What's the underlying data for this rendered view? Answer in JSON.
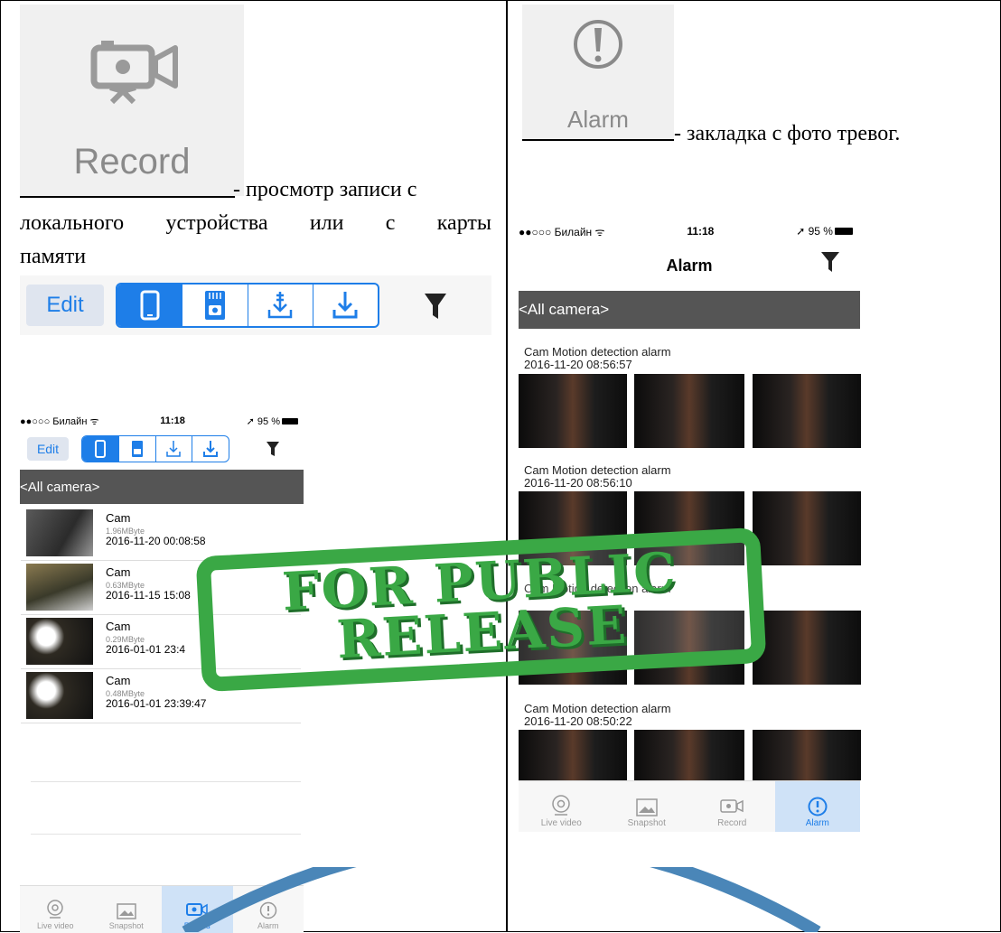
{
  "left_cell": {
    "tile_label": "Record",
    "description": "- просмотр записи с локального устройства или с карты памяти",
    "desc_line1": "- просмотр записи с",
    "desc_line2": "локального устройства или с карты",
    "desc_line3": "памяти",
    "toolbar": {
      "edit_label": "Edit"
    }
  },
  "right_cell": {
    "tile_label": "Alarm",
    "description": "- закладка с фото тревог."
  },
  "record_screen": {
    "status": {
      "carrier": "●●○○○ Билайн ᯤ",
      "time": "11:18",
      "battery": "➚ 95 %"
    },
    "toolbar": {
      "edit_label": "Edit"
    },
    "camera_filter": "<All camera>",
    "records": [
      {
        "name": "Cam",
        "size": "1.96MByte",
        "date": "2016-11-20 00:08:58"
      },
      {
        "name": "Cam",
        "size": "0.63MByte",
        "date": "2016-11-15 15:08"
      },
      {
        "name": "Cam",
        "size": "0.29MByte",
        "date": "2016-01-01 23:4"
      },
      {
        "name": "Cam",
        "size": "0.48MByte",
        "date": "2016-01-01 23:39:47"
      }
    ],
    "tabs": [
      {
        "label": "Live video",
        "icon": "live-video-icon",
        "active": false
      },
      {
        "label": "Snapshot",
        "icon": "snapshot-icon",
        "active": false
      },
      {
        "label": "Record",
        "icon": "record-icon",
        "active": true
      },
      {
        "label": "Alarm",
        "icon": "alarm-icon",
        "active": false
      }
    ]
  },
  "alarm_screen": {
    "status": {
      "carrier": "●●○○○ Билайн ᯤ",
      "time": "11:18",
      "battery": "➚ 95 %"
    },
    "title": "Alarm",
    "camera_filter": "<All camera>",
    "groups": [
      {
        "title": "Cam Motion detection alarm",
        "date": "2016-11-20 08:56:57"
      },
      {
        "title": "Cam Motion detection alarm",
        "date": "2016-11-20 08:56:10"
      },
      {
        "title": "Cam Motion detection alarm",
        "date": ""
      },
      {
        "title": "Cam Motion detection alarm",
        "date": "2016-11-20 08:50:22"
      }
    ],
    "tabs": [
      {
        "label": "Live video",
        "icon": "live-video-icon",
        "active": false
      },
      {
        "label": "Snapshot",
        "icon": "snapshot-icon",
        "active": false
      },
      {
        "label": "Record",
        "icon": "record-icon",
        "active": false
      },
      {
        "label": "Alarm",
        "icon": "alarm-icon",
        "active": true
      }
    ]
  },
  "stamp": {
    "line1": "FOR PUBLIC",
    "line2": "RELEASE"
  },
  "colors": {
    "accent": "#1e7ee8",
    "stamp_green": "#3aa845",
    "dark_bar": "#555555",
    "circle_blue": "#4a86b8"
  }
}
